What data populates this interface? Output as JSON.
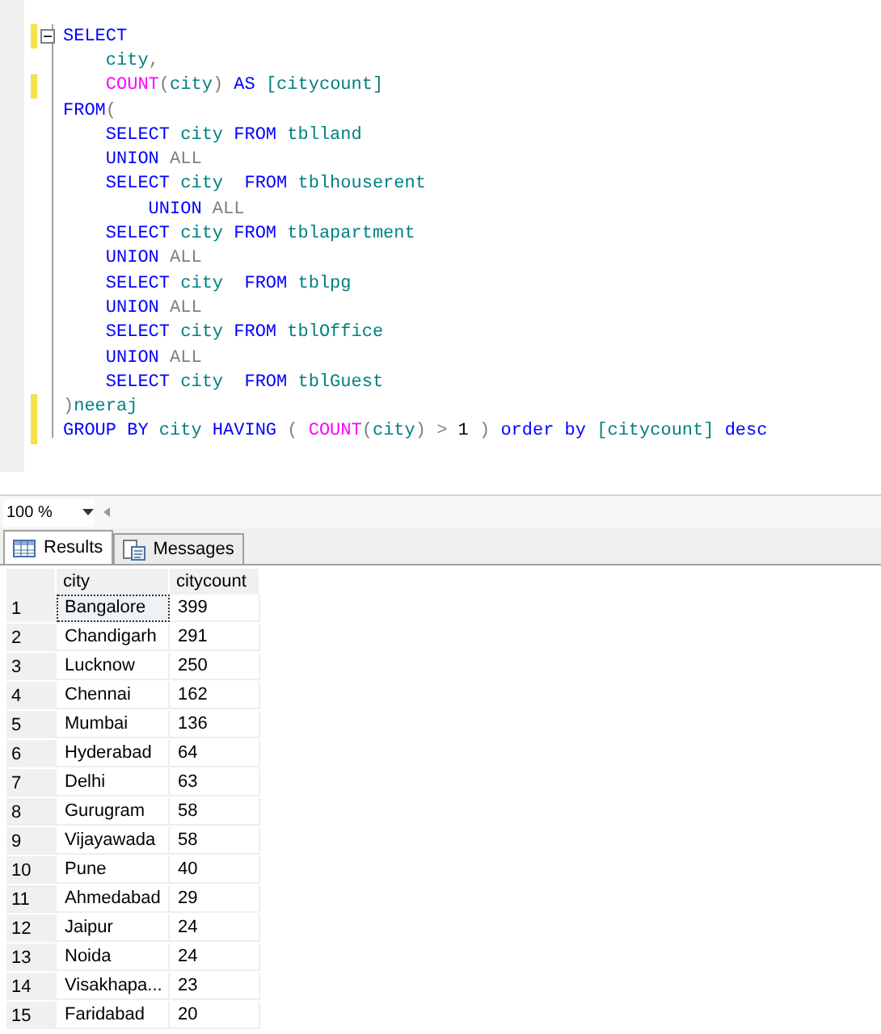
{
  "editor": {
    "lines": [
      {
        "changed": true,
        "fold": true,
        "tokens": [
          {
            "kind": "keyword",
            "text": "SELECT"
          }
        ]
      },
      {
        "changed": false,
        "tokens": [
          {
            "kind": "ident",
            "text": "    city"
          },
          {
            "kind": "op",
            "text": ","
          }
        ]
      },
      {
        "changed": true,
        "tokens": [
          {
            "kind": "function",
            "text": "    COUNT"
          },
          {
            "kind": "op",
            "text": "("
          },
          {
            "kind": "ident",
            "text": "city"
          },
          {
            "kind": "op",
            "text": ")"
          },
          {
            "kind": "keyword",
            "text": " AS"
          },
          {
            "kind": "ident",
            "text": " [citycount]"
          }
        ]
      },
      {
        "changed": false,
        "tokens": [
          {
            "kind": "keyword",
            "text": "FROM"
          },
          {
            "kind": "op",
            "text": "("
          }
        ]
      },
      {
        "changed": false,
        "tokens": [
          {
            "kind": "keyword",
            "text": "    SELECT"
          },
          {
            "kind": "ident",
            "text": " city"
          },
          {
            "kind": "keyword",
            "text": " FROM"
          },
          {
            "kind": "ident",
            "text": " tblland"
          }
        ]
      },
      {
        "changed": false,
        "tokens": [
          {
            "kind": "keyword",
            "text": "    UNION"
          },
          {
            "kind": "op",
            "text": " ALL"
          }
        ]
      },
      {
        "changed": false,
        "tokens": [
          {
            "kind": "keyword",
            "text": "    SELECT"
          },
          {
            "kind": "ident",
            "text": " city"
          },
          {
            "kind": "keyword",
            "text": "  FROM"
          },
          {
            "kind": "ident",
            "text": " tblhouserent"
          }
        ]
      },
      {
        "changed": false,
        "tokens": [
          {
            "kind": "keyword",
            "text": "        UNION"
          },
          {
            "kind": "op",
            "text": " ALL"
          }
        ]
      },
      {
        "changed": false,
        "tokens": [
          {
            "kind": "keyword",
            "text": "    SELECT"
          },
          {
            "kind": "ident",
            "text": " city"
          },
          {
            "kind": "keyword",
            "text": " FROM"
          },
          {
            "kind": "ident",
            "text": " tblapartment"
          }
        ]
      },
      {
        "changed": false,
        "tokens": [
          {
            "kind": "keyword",
            "text": "    UNION"
          },
          {
            "kind": "op",
            "text": " ALL"
          }
        ]
      },
      {
        "changed": false,
        "tokens": [
          {
            "kind": "keyword",
            "text": "    SELECT"
          },
          {
            "kind": "ident",
            "text": " city"
          },
          {
            "kind": "keyword",
            "text": "  FROM"
          },
          {
            "kind": "ident",
            "text": " tblpg"
          }
        ]
      },
      {
        "changed": false,
        "tokens": [
          {
            "kind": "keyword",
            "text": "    UNION"
          },
          {
            "kind": "op",
            "text": " ALL"
          }
        ]
      },
      {
        "changed": false,
        "tokens": [
          {
            "kind": "keyword",
            "text": "    SELECT"
          },
          {
            "kind": "ident",
            "text": " city"
          },
          {
            "kind": "keyword",
            "text": " FROM"
          },
          {
            "kind": "ident",
            "text": " tblOffice"
          }
        ]
      },
      {
        "changed": false,
        "tokens": [
          {
            "kind": "keyword",
            "text": "    UNION"
          },
          {
            "kind": "op",
            "text": " ALL"
          }
        ]
      },
      {
        "changed": false,
        "tokens": [
          {
            "kind": "keyword",
            "text": "    SELECT"
          },
          {
            "kind": "ident",
            "text": " city"
          },
          {
            "kind": "keyword",
            "text": "  FROM"
          },
          {
            "kind": "ident",
            "text": " tblGuest"
          }
        ]
      },
      {
        "changed": true,
        "tokens": [
          {
            "kind": "op",
            "text": ")"
          },
          {
            "kind": "ident",
            "text": "neeraj"
          }
        ]
      },
      {
        "changed": true,
        "tokens": [
          {
            "kind": "keyword",
            "text": "GROUP BY"
          },
          {
            "kind": "ident",
            "text": " city"
          },
          {
            "kind": "keyword",
            "text": " HAVING"
          },
          {
            "kind": "op",
            "text": " ("
          },
          {
            "kind": "function",
            "text": " COUNT"
          },
          {
            "kind": "op",
            "text": "("
          },
          {
            "kind": "ident",
            "text": "city"
          },
          {
            "kind": "op",
            "text": ")"
          },
          {
            "kind": "op",
            "text": " >"
          },
          {
            "kind": "plain",
            "text": " 1"
          },
          {
            "kind": "op",
            "text": " )"
          },
          {
            "kind": "keyword",
            "text": " order by"
          },
          {
            "kind": "ident",
            "text": " [citycount]"
          },
          {
            "kind": "keyword",
            "text": " desc"
          }
        ]
      }
    ]
  },
  "zoom": {
    "value": "100 %"
  },
  "tabs": [
    {
      "label": "Results",
      "selected": true
    },
    {
      "label": "Messages",
      "selected": false
    }
  ],
  "grid": {
    "columns": [
      "city",
      "citycount"
    ],
    "rows": [
      {
        "number": "1",
        "cells": [
          "Bangalore",
          "399"
        ],
        "selected": true
      },
      {
        "number": "2",
        "cells": [
          "Chandigarh",
          "291"
        ],
        "selected": false
      },
      {
        "number": "3",
        "cells": [
          "Lucknow",
          "250"
        ],
        "selected": false
      },
      {
        "number": "4",
        "cells": [
          "Chennai",
          "162"
        ],
        "selected": false
      },
      {
        "number": "5",
        "cells": [
          "Mumbai",
          "136"
        ],
        "selected": false
      },
      {
        "number": "6",
        "cells": [
          "Hyderabad",
          "64"
        ],
        "selected": false
      },
      {
        "number": "7",
        "cells": [
          "Delhi",
          "63"
        ],
        "selected": false
      },
      {
        "number": "8",
        "cells": [
          "Gurugram",
          "58"
        ],
        "selected": false
      },
      {
        "number": "9",
        "cells": [
          "Vijayawada",
          "58"
        ],
        "selected": false
      },
      {
        "number": "10",
        "cells": [
          "Pune",
          "40"
        ],
        "selected": false
      },
      {
        "number": "11",
        "cells": [
          "Ahmedabad",
          "29"
        ],
        "selected": false
      },
      {
        "number": "12",
        "cells": [
          "Jaipur",
          "24"
        ],
        "selected": false
      },
      {
        "number": "13",
        "cells": [
          "Noida",
          "24"
        ],
        "selected": false
      },
      {
        "number": "14",
        "cells": [
          "Visakhapa...",
          "23"
        ],
        "selected": false
      },
      {
        "number": "15",
        "cells": [
          "Faridabad",
          "20"
        ],
        "selected": false
      }
    ]
  }
}
